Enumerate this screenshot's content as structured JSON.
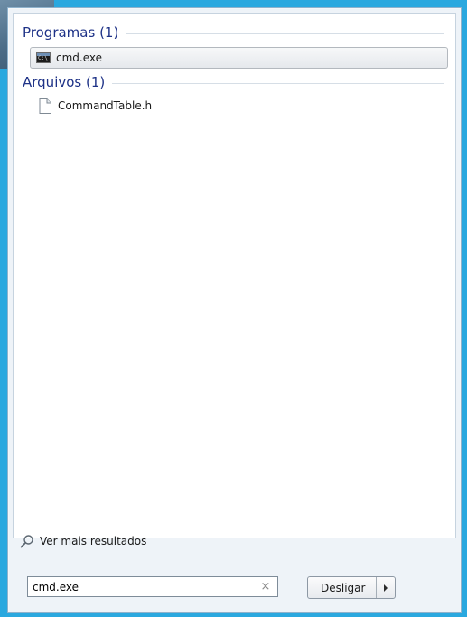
{
  "results": {
    "programs": {
      "header": "Programas (1)",
      "items": [
        {
          "label": "cmd.exe",
          "icon": "cmd-icon"
        }
      ]
    },
    "files": {
      "header": "Arquivos (1)",
      "items": [
        {
          "label": "CommandTable.h",
          "icon": "file-icon"
        }
      ]
    }
  },
  "more_results": "Ver mais resultados",
  "search": {
    "value": "cmd.exe",
    "clear_glyph": "×"
  },
  "shutdown": {
    "label": "Desligar"
  },
  "colors": {
    "desktop_background": "#2aa8df",
    "group_title": "#1e3287"
  }
}
